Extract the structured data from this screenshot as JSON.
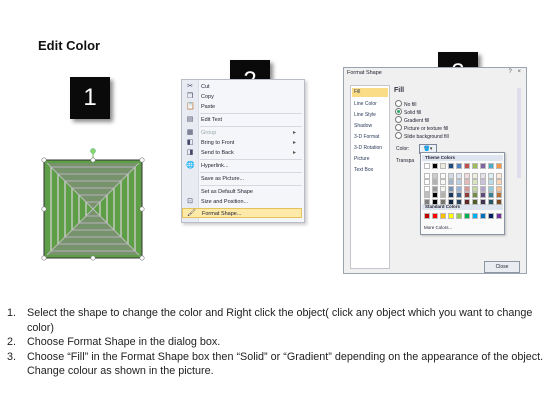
{
  "title": "Edit Color",
  "badges": [
    "1",
    "2",
    "3"
  ],
  "context_menu": {
    "items": [
      {
        "label": "Cut",
        "icon": "scissors-icon",
        "disabled": false
      },
      {
        "label": "Copy",
        "icon": "copy-icon",
        "disabled": false
      },
      {
        "label": "Paste",
        "icon": "paste-icon",
        "disabled": false
      },
      {
        "label": "Edit Text",
        "icon": "edit-text-icon",
        "disabled": false
      },
      {
        "label": "Group",
        "icon": "group-icon",
        "disabled": true,
        "submenu": true
      },
      {
        "label": "Bring to Front",
        "icon": "bring-to-front-icon",
        "disabled": false,
        "submenu": true
      },
      {
        "label": "Send to Back",
        "icon": "send-to-back-icon",
        "disabled": false,
        "submenu": true
      },
      {
        "label": "Hyperlink...",
        "icon": "hyperlink-icon",
        "disabled": false
      },
      {
        "label": "Save as Picture...",
        "icon": "",
        "disabled": false
      },
      {
        "label": "Set as Default Shape",
        "icon": "",
        "disabled": false
      },
      {
        "label": "Size and Position...",
        "icon": "size-icon",
        "disabled": false
      },
      {
        "label": "Format Shape...",
        "icon": "format-shape-icon",
        "disabled": false,
        "highlighted": true
      }
    ]
  },
  "dialog": {
    "title": "Format Shape",
    "controls": "? ×",
    "nav": [
      "Fill",
      "Line Color",
      "Line Style",
      "Shadow",
      "3-D Format",
      "3-D Rotation",
      "Picture",
      "Text Box"
    ],
    "section_title": "Fill",
    "options": [
      {
        "label": "No fill",
        "type": "radio",
        "selected": false
      },
      {
        "label": "Solid fill",
        "type": "radio",
        "selected": true
      },
      {
        "label": "Gradient fill",
        "type": "radio",
        "selected": false
      },
      {
        "label": "Picture or texture fill",
        "type": "radio",
        "selected": false
      },
      {
        "label": "Slide background fill",
        "type": "radio",
        "selected": false
      }
    ],
    "color_label": "Color:",
    "transparency_label": "Transpa",
    "close_label": "Close"
  },
  "palette": {
    "theme_title": "Theme Colors",
    "standard_title": "Standard Colors",
    "more_label": "More Colors...",
    "theme_top": [
      "#ffffff",
      "#000000",
      "#eeece1",
      "#1f497d",
      "#4f81bd",
      "#c0504d",
      "#9bbb59",
      "#8064a2",
      "#4bacc6",
      "#f79646"
    ],
    "standard": [
      "#c00000",
      "#ff0000",
      "#ffc000",
      "#ffff00",
      "#92d050",
      "#00b050",
      "#00b0f0",
      "#0070c0",
      "#002060",
      "#7030a0"
    ]
  },
  "steps": [
    {
      "num": "1.",
      "text": "Select the shape to change the color and Right click the object( click any object which you want to change color)"
    },
    {
      "num": "2.",
      "text": "Choose Format Shape in the dialog box."
    },
    {
      "num": "3.",
      "text": "Choose “Fill” in the Format Shape box then “Solid” or “Gradient” depending on the appearance of the object. Change colour as shown in the picture."
    }
  ]
}
